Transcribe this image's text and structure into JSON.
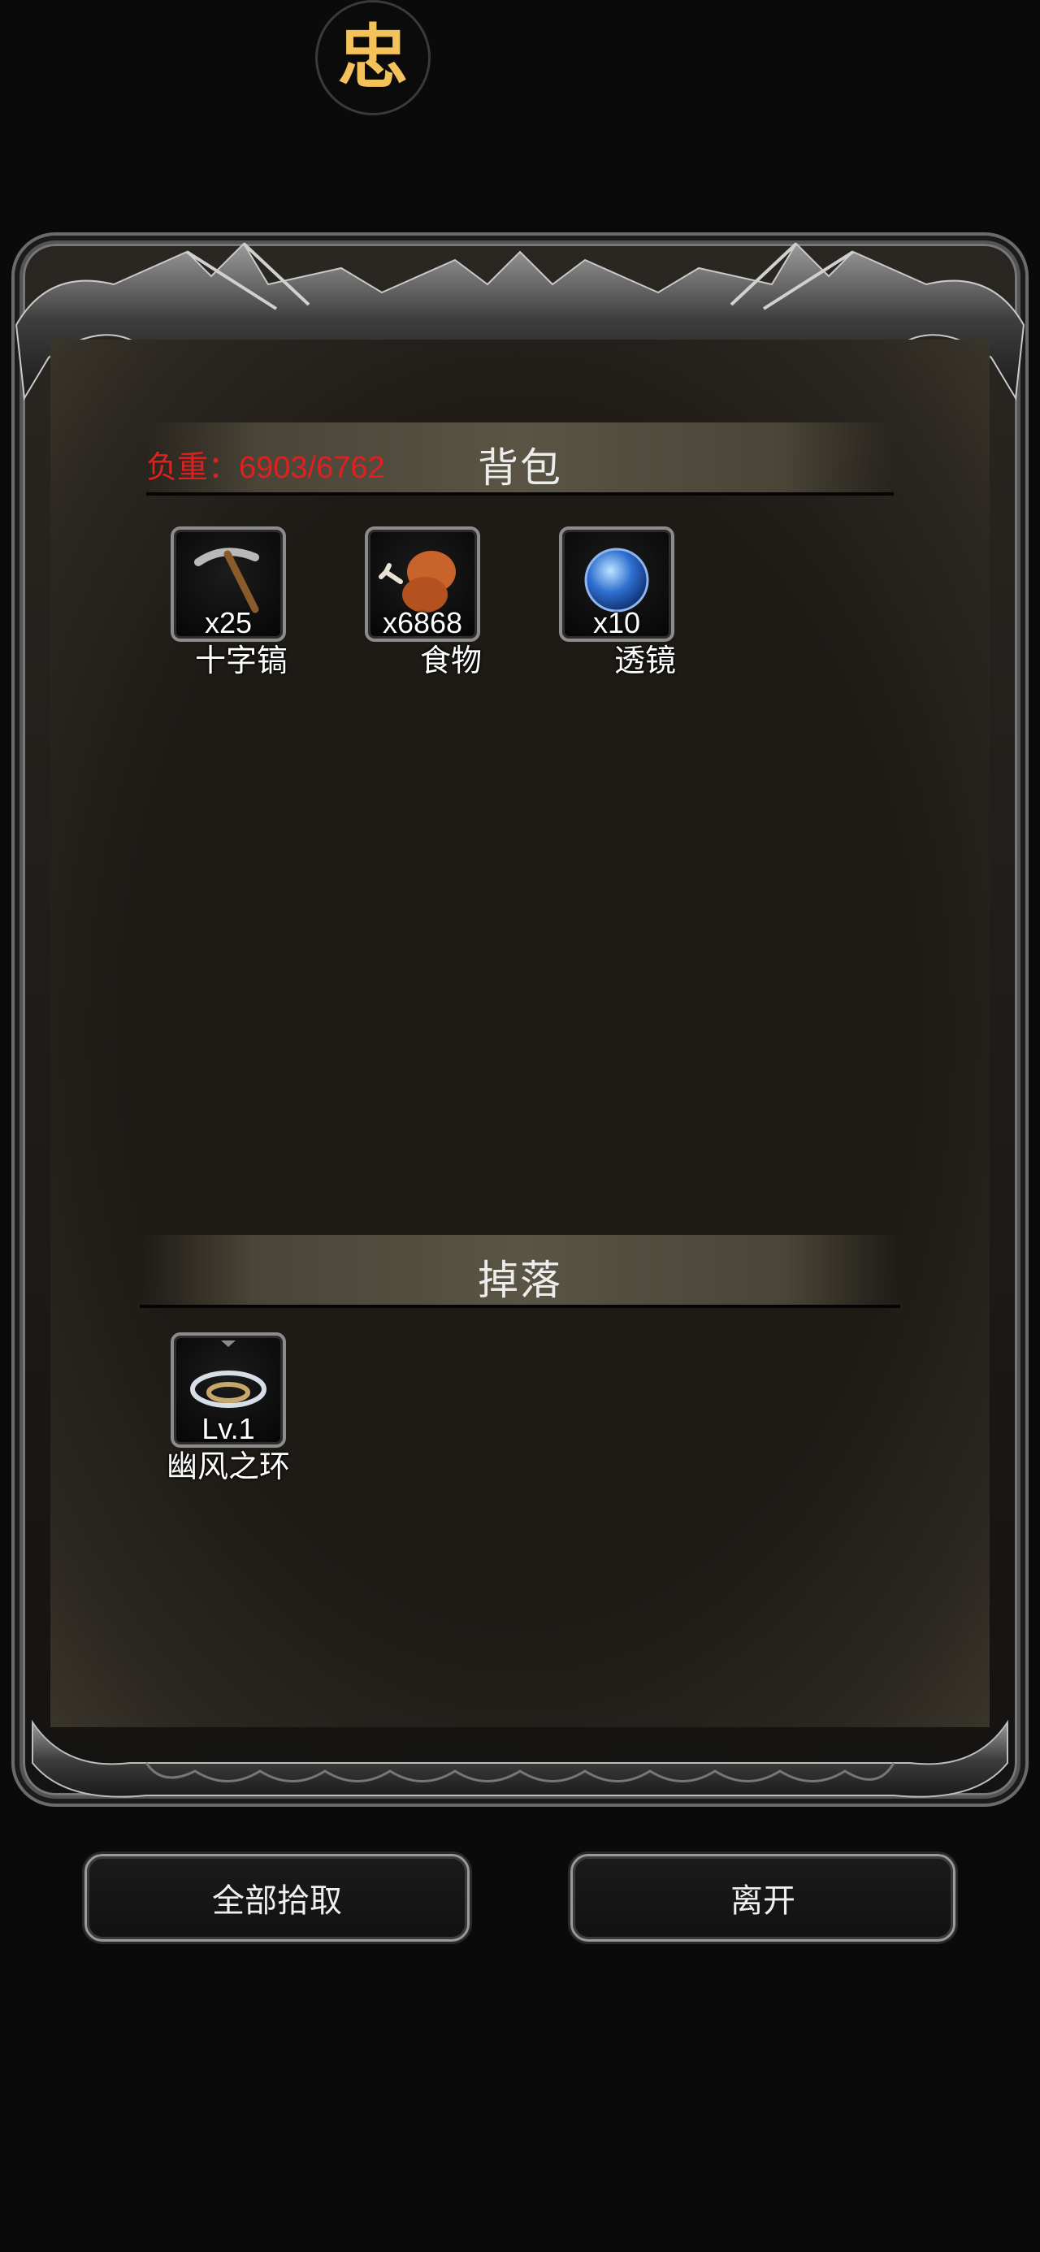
{
  "logo": {
    "glyph": "忠",
    "icon": "app-logo-icon"
  },
  "load": {
    "text": "负重：6903/6762"
  },
  "bag": {
    "title": "背包",
    "items": [
      {
        "icon": "pickaxe-icon",
        "quantity": "x25",
        "name": "十字镐"
      },
      {
        "icon": "food-drumstick-icon",
        "quantity": "x6868",
        "name": "食物"
      },
      {
        "icon": "lens-orb-icon",
        "quantity": "x10",
        "name": "透镜"
      }
    ]
  },
  "drops": {
    "title": "掉落",
    "items": [
      {
        "icon": "ring-icon",
        "level": "Lv.1",
        "name": "幽风之环"
      }
    ]
  },
  "buttons": {
    "pick_all": "全部拾取",
    "leave": "离开"
  },
  "colors": {
    "load_text": "#e02020",
    "logo": "#f3c25a"
  }
}
